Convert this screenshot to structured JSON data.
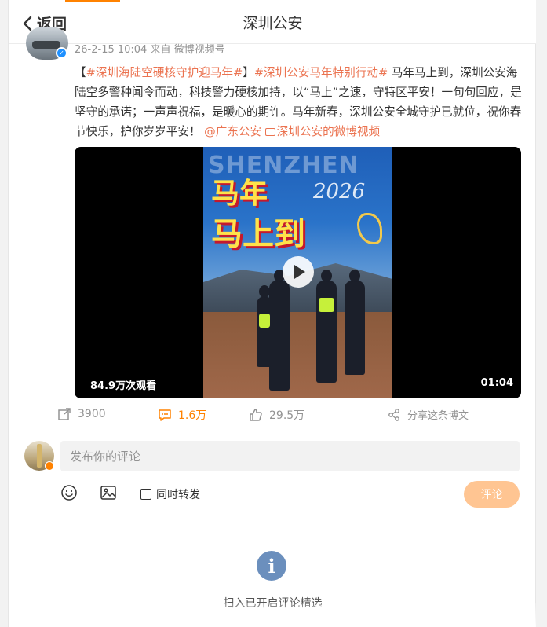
{
  "header": {
    "back_label": "返回",
    "title": "深圳公安"
  },
  "post": {
    "meta": "26-2-15 10:04 来自 微博视频号",
    "bracket_open": "【",
    "topic1": "#深圳海陆空硬核守护迎马年#",
    "bracket_close": "】",
    "topic2": "#深圳公安马年特别行动#",
    "body": " 马年马上到，深圳公安海陆空多警种闻令而动，科技警力硬核加持，以“马上”之速，守特区平安！一句句回应，是坚守的承诺；一声声祝福，是暖心的期许。马年新春，深圳公安全城守护已就位，祝你春节快乐，护你岁岁平安！ ",
    "mention": "@广东公安",
    "video_link": "深圳公安的微博视频"
  },
  "video": {
    "poster_bg_text": "SHENZHEN",
    "poster_line1": "马年",
    "poster_year": "2026",
    "poster_line2": "马上到",
    "views": "84.9万次观看",
    "duration": "01:04"
  },
  "actions": {
    "repost_count": "3900",
    "comment_count": "1.6万",
    "like_count": "29.5万",
    "share_label": "分享这条博文"
  },
  "comment": {
    "placeholder": "发布你的评论",
    "repost_checkbox_label": "同时转发",
    "submit_label": "评论"
  },
  "footer": {
    "info_text": "扫入已开启评论精选"
  },
  "colors": {
    "accent": "#ff8200",
    "link": "#eb7350",
    "submit_disabled": "#ffc592",
    "info_icon": "#6b8fbd"
  }
}
